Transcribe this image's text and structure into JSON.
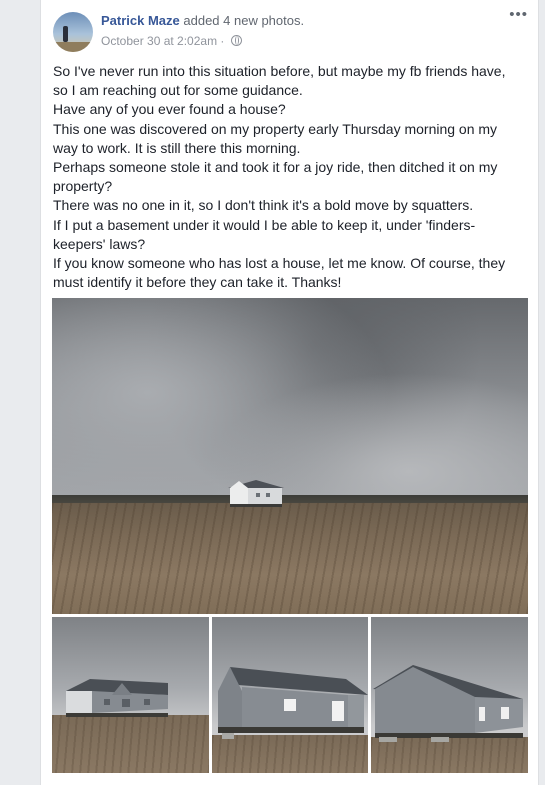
{
  "post": {
    "author": "Patrick Maze",
    "action": " added 4 new photos.",
    "timestamp": "October 30 at 2:02am",
    "separator": " · ",
    "privacy_icon": "globe-icon",
    "more_icon": "more-options-icon",
    "lines": [
      "So I've never run into this situation before, but maybe my fb friends have,",
      "so I am reaching out for some guidance.",
      "Have any of you ever found a house?",
      "This one was discovered on my property early Thursday morning on my",
      "way to work. It is still there this morning.",
      "Perhaps someone stole it and took it for a joy ride, then ditched it on my",
      "property?",
      "There was no one in it, so I don't think it's a bold move by squatters.",
      "If I put a basement under it would I be able to keep it, under 'finders-",
      "keepers' laws?",
      "If you know someone who has lost a house, let me know. Of course, they",
      "must identify it before they can take it. Thanks!"
    ]
  },
  "colors": {
    "author_link": "#385898",
    "meta_text": "#90949c",
    "page_bg": "#e9ebee",
    "house_siding": "#858a90",
    "house_roof": "#4a4f55"
  }
}
